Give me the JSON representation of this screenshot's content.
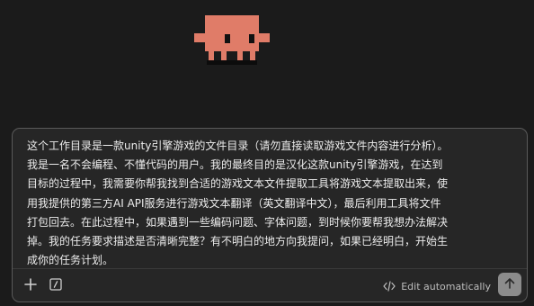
{
  "mascot": {
    "icon": "pixel-crab-mascot-icon",
    "body_color": "#e07c68",
    "eye_color": "#111111"
  },
  "composer": {
    "prompt_text": "这个工作目录是一款unity引擎游戏的文件目录（请勿直接读取游戏文件内容进行分析）。\n我是一名不会编程、不懂代码的用户。我的最终目的是汉化这款unity引擎游戏，在达到\n目标的过程中，我需要你帮我找到合适的游戏文本文件提取工具将游戏文本提取出来，使\n用我提供的第三方AI API服务进行游戏文本翻译（英文翻译中文），最后利用工具将文件\n打包回去。在此过程中，如果遇到一些编码问题、字体问题，到时候你要帮我想办法解决\n掉。我的任务要求描述是否清晰完整？有不明白的地方向我提问，如果已经明白，开始生\n成你的任务计划。",
    "add_icon": "plus-icon",
    "slash_icon": "slash-command-icon",
    "edit_mode_icon": "code-icon",
    "edit_mode_label": "Edit automatically",
    "send_icon": "arrow-up-icon",
    "send_button_color": "#8c8c8c"
  }
}
